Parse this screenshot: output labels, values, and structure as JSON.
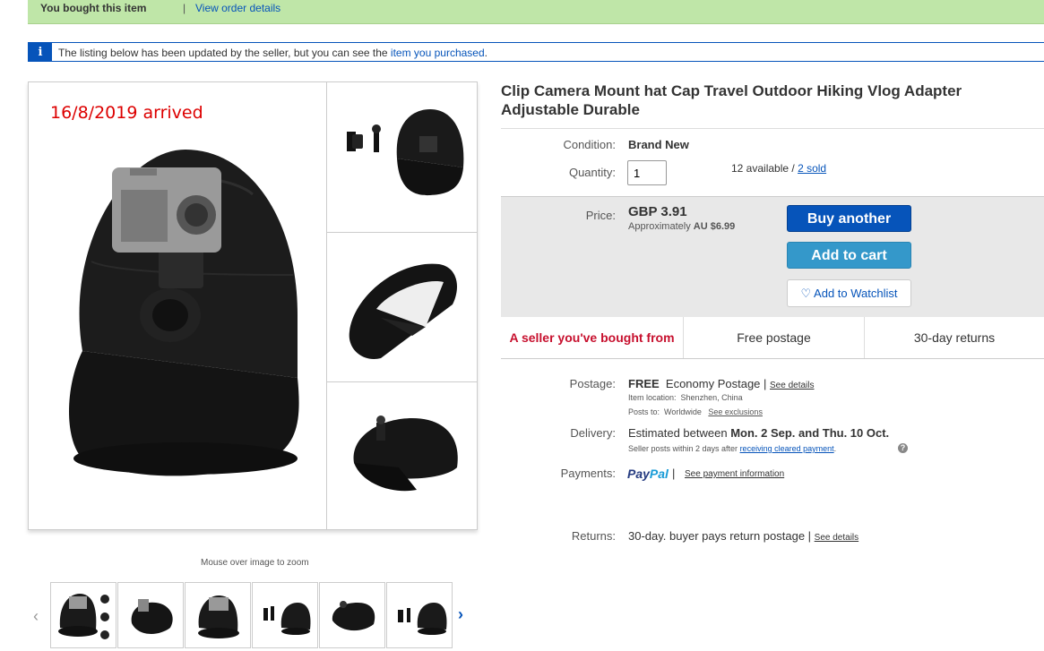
{
  "banner": {
    "bought": "You bought this item",
    "separator": "|",
    "order_link": "View order details"
  },
  "notice": {
    "icon": "info-icon",
    "text_before": "The listing below has been updated by the seller, but you can see the ",
    "link": "item you purchased",
    "text_after": "."
  },
  "gallery": {
    "overlay_text": "16/8/2019 arrived",
    "zoom_hint": "Mouse over image to zoom",
    "prev_arrow": "‹",
    "next_arrow": "›",
    "thumbnail_count": 6
  },
  "listing": {
    "title": "Clip Camera Mount hat Cap Travel Outdoor Hiking Vlog Adapter Adjustable Durable",
    "condition_label": "Condition:",
    "condition_value": "Brand New",
    "quantity_label": "Quantity:",
    "quantity_value": "1",
    "available": "12 available / ",
    "sold": "2 sold",
    "price_label": "Price:",
    "price": "GBP 3.91",
    "approx_prefix": "Approximately ",
    "approx_value": "AU $6.99"
  },
  "actions": {
    "buy_another": "Buy another",
    "add_to_cart": "Add to cart",
    "watchlist": "Add to Watchlist",
    "watch_icon": "heart-icon"
  },
  "badges": [
    "A seller you've bought from",
    "Free postage",
    "30-day returns"
  ],
  "postage": {
    "label": "Postage:",
    "free": "FREE",
    "service": "Economy Postage | ",
    "details_link": "See details",
    "location_label": "Item location:",
    "location": "Shenzhen, China",
    "posts_to_label": "Posts to:",
    "posts_to": "Worldwide",
    "exclusions_link": "See exclusions"
  },
  "delivery": {
    "label": "Delivery:",
    "prefix": "Estimated between ",
    "dates": "Mon. 2 Sep. and Thu. 10 Oct.",
    "note_prefix": "Seller posts within 2 days after ",
    "note_link": "receiving cleared payment",
    "note_suffix": ".",
    "help_icon": "?"
  },
  "payments": {
    "label": "Payments:",
    "paypal_1": "Pay",
    "paypal_2": "Pal",
    "separator": " | ",
    "info_link": "See payment information"
  },
  "returns": {
    "label": "Returns:",
    "text": "30-day. buyer pays return postage | ",
    "details_link": "See details"
  },
  "colors": {
    "banner_green": "#bfe6a8",
    "link_blue": "#0654ba",
    "buy_blue": "#0654ba",
    "cart_blue": "#3498ca",
    "seller_red": "#c7102e"
  }
}
